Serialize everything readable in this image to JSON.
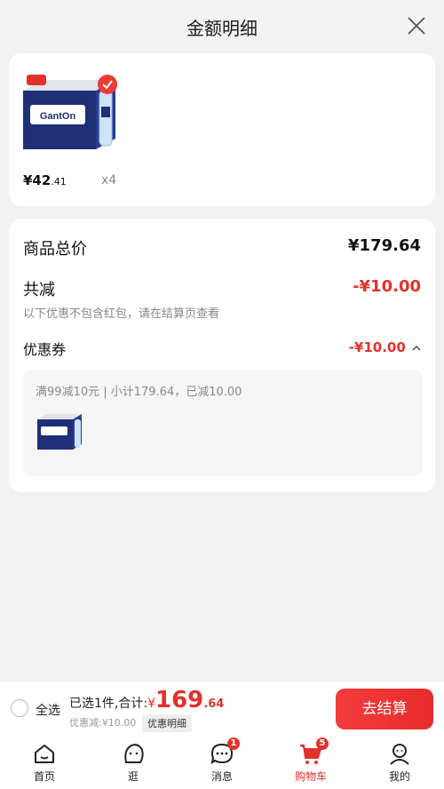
{
  "header": {
    "title": "金额明细"
  },
  "item": {
    "price_int": "¥42",
    "price_dec": ".41",
    "qty": "x4",
    "brand": "GantOn"
  },
  "totals": {
    "goods_label": "商品总价",
    "goods_value": "¥179.64",
    "discount_label": "共减",
    "discount_value": "-¥10.00",
    "note": "以下优惠不包含红包，请在结算页查看",
    "coupon_label": "优惠券",
    "coupon_value": "-¥10.00",
    "coupon_detail": "满99减10元 | 小计179.64，已减10.00"
  },
  "bottom": {
    "select_all": "全选",
    "summary_prefix": "已选1件,合计:",
    "yen": "¥",
    "total_int": "169",
    "total_dec": ".64",
    "saved": "优惠减:¥10.00",
    "detail_btn": "优惠明细",
    "checkout": "去结算"
  },
  "tabs": [
    {
      "label": "首页",
      "icon": "home-icon"
    },
    {
      "label": "逛",
      "icon": "face-icon"
    },
    {
      "label": "消息",
      "icon": "message-icon",
      "badge": "1"
    },
    {
      "label": "购物车",
      "icon": "cart-icon",
      "badge": "5",
      "active": true
    },
    {
      "label": "我的",
      "icon": "user-icon"
    }
  ],
  "colors": {
    "accent": "#e3312b",
    "background": "#f2f2f2"
  }
}
